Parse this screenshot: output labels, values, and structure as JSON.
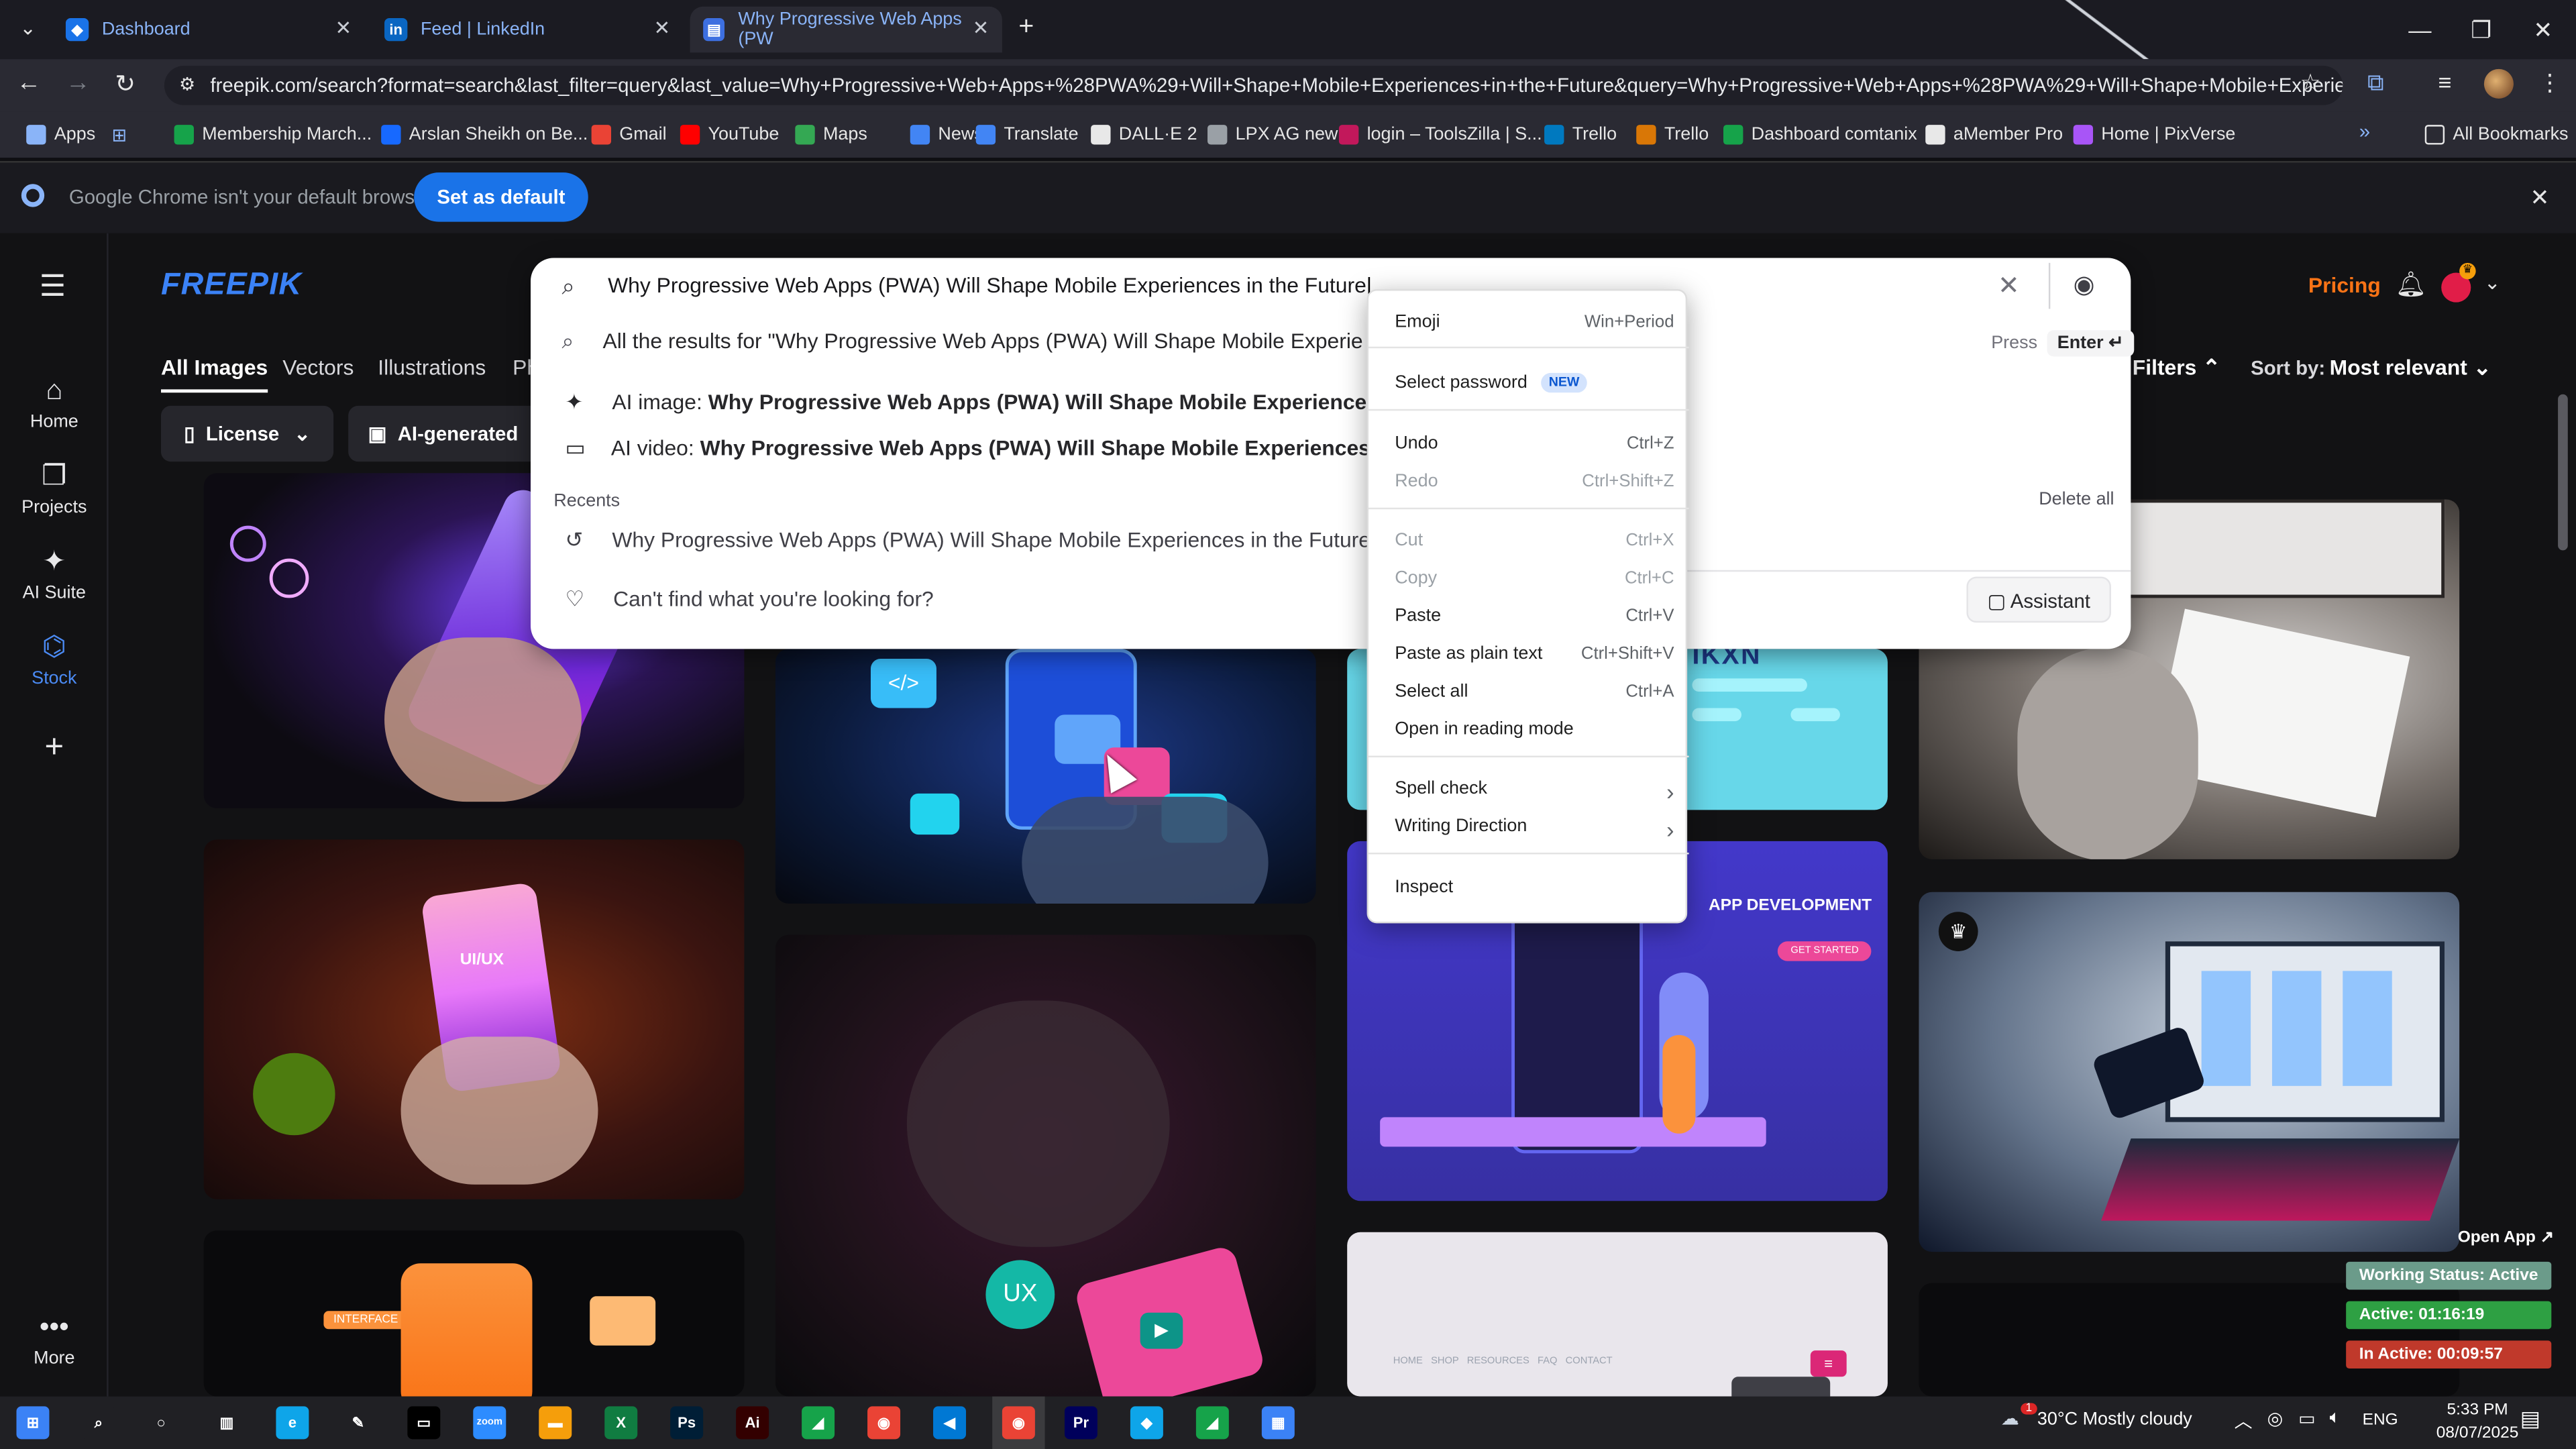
{
  "browser": {
    "tabs": [
      {
        "label": "Dashboard",
        "color": "#1a73e8"
      },
      {
        "label": "Feed | LinkedIn",
        "color": "#0a66c2"
      },
      {
        "label": "Why Progressive Web Apps (PW",
        "color": "#3d6fe0"
      }
    ],
    "url": "freepik.com/search?format=search&last_filter=query&last_value=Why+Progressive+Web+Apps+%28PWA%29+Will+Shape+Mobile+Experiences+in+the+Future&query=Why+Progressive+Web+Apps+%28PWA%29+Will+Shape+Mobile+Experien...",
    "bookmarks": [
      {
        "label": "Apps",
        "color": "#8ab4f8"
      },
      {
        "label": "Membership March...",
        "color": "#16a34a"
      },
      {
        "label": "Arslan Sheikh on Be...",
        "color": "#1769ff"
      },
      {
        "label": "Gmail",
        "color": "#ea4335"
      },
      {
        "label": "YouTube",
        "color": "#ff0000"
      },
      {
        "label": "Maps",
        "color": "#34a853"
      },
      {
        "label": "News",
        "color": "#4285f4"
      },
      {
        "label": "Translate",
        "color": "#4285f4"
      },
      {
        "label": "DALL·E 2",
        "color": "#e8e8e8"
      },
      {
        "label": "LPX AG new",
        "color": "#9aa0a6"
      },
      {
        "label": "login – ToolsZilla | S...",
        "color": "#c2185b"
      },
      {
        "label": "Trello",
        "color": "#0079bf"
      },
      {
        "label": "Trello",
        "color": "#d97706"
      },
      {
        "label": "Dashboard comtanix",
        "color": "#16a34a"
      },
      {
        "label": "aMember Pro",
        "color": "#e8e8e8"
      },
      {
        "label": "Home | PixVerse",
        "color": "#a855f7"
      }
    ],
    "all_bookmarks": "All Bookmarks",
    "infobar_text": "Google Chrome isn't your default browser",
    "infobar_button": "Set as default"
  },
  "site": {
    "logo": "FREEPIK",
    "search_value": "Why Progressive Web Apps (PWA) Will Shape Mobile Experiences in the Future",
    "pricing": "Pricing",
    "sidebar": [
      {
        "label": "Home",
        "icon": "home-icon"
      },
      {
        "label": "Projects",
        "icon": "projects-icon"
      },
      {
        "label": "AI Suite",
        "icon": "ai-suite-icon"
      },
      {
        "label": "Stock",
        "icon": "stock-icon"
      },
      {
        "label": "More",
        "icon": "more-icon"
      }
    ],
    "filter_tabs": [
      "All Images",
      "Vectors",
      "Illustrations",
      "Ph"
    ],
    "filters_label": "Filters",
    "sort_label": "Sort by:",
    "sort_value": "Most relevant",
    "license_label": "License",
    "ai_generated_label": "AI-generated",
    "dropdown": {
      "all_results_prefix": "All the results for \"",
      "all_results_query": "Why Progressive Web Apps (PWA) Will Shape Mobile Experie",
      "press_label": "Press",
      "enter_label": "Enter ↵",
      "ai_image_prefix": "AI image: ",
      "ai_image_query": "Why Progressive Web Apps (PWA) Will Shape Mobile Experiences in",
      "ai_video_prefix": "AI video: ",
      "ai_video_query": "Why Progressive Web Apps (PWA) Will Shape Mobile Experiences in",
      "recents_label": "Recents",
      "delete_all": "Delete all",
      "recent_item": "Why Progressive Web Apps (PWA) Will Shape Mobile Experiences in the Future",
      "cant_find": "Can't find what you're looking for?",
      "assistant": "Assistant"
    },
    "card_texts": {
      "app_development": "APP DEVELOPMENT",
      "get_started": "GET STARTED",
      "uiux": "UI/UX",
      "interface": "INTERFACE",
      "ux": "UX",
      "nav_links": "HOME   SHOP   RESOURCES   FAQ   CONTACT",
      "code_tag": "</>",
      "brand_partial": "IKXN"
    }
  },
  "context_menu": [
    {
      "label": "Emoji",
      "shortcut": "Win+Period"
    },
    {
      "label": "Select password",
      "badge": "NEW"
    },
    {
      "label": "Undo",
      "shortcut": "Ctrl+Z"
    },
    {
      "label": "Redo",
      "shortcut": "Ctrl+Shift+Z"
    },
    {
      "label": "Cut",
      "shortcut": "Ctrl+X"
    },
    {
      "label": "Copy",
      "shortcut": "Ctrl+C"
    },
    {
      "label": "Paste",
      "shortcut": "Ctrl+V"
    },
    {
      "label": "Paste as plain text",
      "shortcut": "Ctrl+Shift+V"
    },
    {
      "label": "Select all",
      "shortcut": "Ctrl+A"
    },
    {
      "label": "Open in reading mode",
      "shortcut": ""
    },
    {
      "label": "Spell check",
      "shortcut": "›"
    },
    {
      "label": "Writing Direction",
      "shortcut": "›"
    },
    {
      "label": "Inspect",
      "shortcut": ""
    }
  ],
  "tracker": {
    "open_app": "Open App ↗",
    "working_status": "Working Status: Active",
    "active": "Active: 01:16:19",
    "inactive": "In Active: 00:09:57"
  },
  "taskbar": {
    "weather": "30°C  Mostly cloudy",
    "weather_badge": "1",
    "lang": "ENG",
    "time": "5:33 PM",
    "date": "08/07/2025",
    "apps": [
      {
        "name": "windows-start",
        "color": "#3b82f6",
        "glyph": "⊞"
      },
      {
        "name": "search",
        "color": "#202024",
        "glyph": "⌕"
      },
      {
        "name": "cortana",
        "color": "#202024",
        "glyph": "○"
      },
      {
        "name": "task-view",
        "color": "#202024",
        "glyph": "▥"
      },
      {
        "name": "edge",
        "color": "#0ea5e9",
        "glyph": "e"
      },
      {
        "name": "pen",
        "color": "#202024",
        "glyph": "✎"
      },
      {
        "name": "terminal",
        "color": "#000000",
        "glyph": "▭"
      },
      {
        "name": "zoom",
        "color": "#2d8cff",
        "glyph": "zoom"
      },
      {
        "name": "explorer",
        "color": "#f59e0b",
        "glyph": "▬"
      },
      {
        "name": "excel",
        "color": "#107c41",
        "glyph": "X"
      },
      {
        "name": "photoshop",
        "color": "#001e36",
        "glyph": "Ps"
      },
      {
        "name": "illustrator",
        "color": "#330000",
        "glyph": "Ai"
      },
      {
        "name": "app-green",
        "color": "#16a34a",
        "glyph": "◢"
      },
      {
        "name": "chrome",
        "color": "#ea4335",
        "glyph": "◉"
      },
      {
        "name": "vscode",
        "color": "#0078d4",
        "glyph": "◀"
      },
      {
        "name": "chrome-active",
        "color": "#ea4335",
        "glyph": "◉"
      },
      {
        "name": "premiere",
        "color": "#00005b",
        "glyph": "Pr"
      },
      {
        "name": "app-diamond",
        "color": "#0ea5e9",
        "glyph": "◆"
      },
      {
        "name": "app-green2",
        "color": "#16a34a",
        "glyph": "◢"
      },
      {
        "name": "calculator",
        "color": "#3b82f6",
        "glyph": "▦"
      }
    ]
  }
}
